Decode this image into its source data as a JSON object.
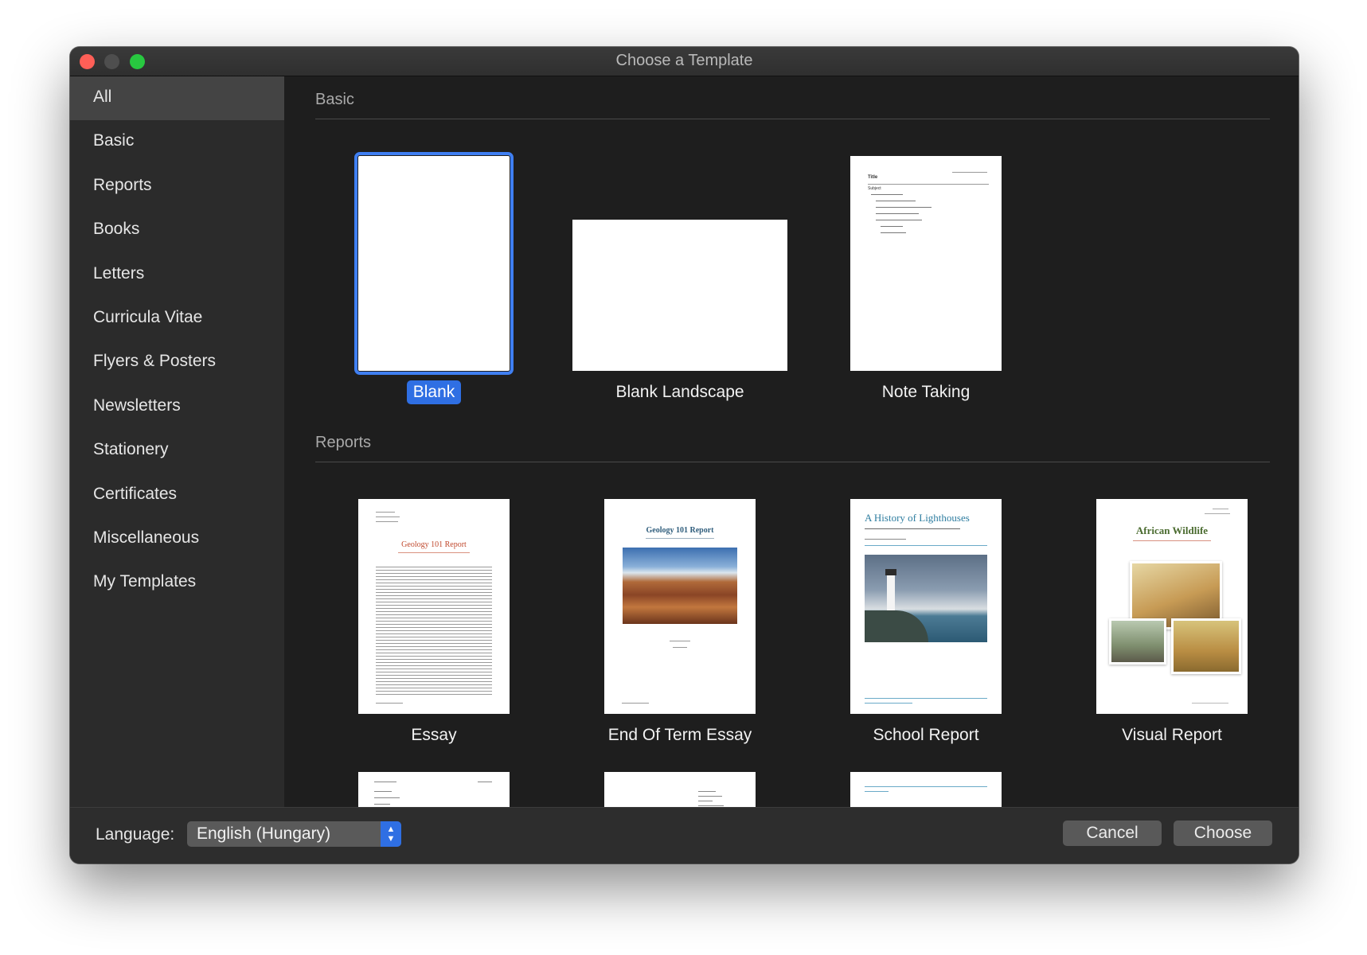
{
  "window": {
    "title": "Choose a Template"
  },
  "sidebar": {
    "items": [
      {
        "label": "All",
        "selected": true
      },
      {
        "label": "Basic"
      },
      {
        "label": "Reports"
      },
      {
        "label": "Books"
      },
      {
        "label": "Letters"
      },
      {
        "label": "Curricula Vitae"
      },
      {
        "label": "Flyers & Posters"
      },
      {
        "label": "Newsletters"
      },
      {
        "label": "Stationery"
      },
      {
        "label": "Certificates"
      },
      {
        "label": "Miscellaneous"
      },
      {
        "label": "My Templates"
      }
    ]
  },
  "sections": [
    {
      "title": "Basic",
      "templates": [
        {
          "label": "Blank",
          "selected": true
        },
        {
          "label": "Blank Landscape"
        },
        {
          "label": "Note Taking"
        }
      ]
    },
    {
      "title": "Reports",
      "templates": [
        {
          "label": "Essay"
        },
        {
          "label": "End Of Term Essay"
        },
        {
          "label": "School Report"
        },
        {
          "label": "Visual Report"
        }
      ]
    }
  ],
  "thumbnails": {
    "note_title": "Title",
    "note_subject": "Subject",
    "essay_title": "Geology 101 Report",
    "end_term_title": "Geology 101 Report",
    "school_title": "A History of Lighthouses",
    "visual_title": "African Wildlife"
  },
  "footer": {
    "language_label": "Language:",
    "language_value": "English (Hungary)",
    "cancel_label": "Cancel",
    "choose_label": "Choose"
  },
  "colors": {
    "accent": "#2f6fe3",
    "close": "#fe5f57",
    "zoom": "#28c840"
  }
}
